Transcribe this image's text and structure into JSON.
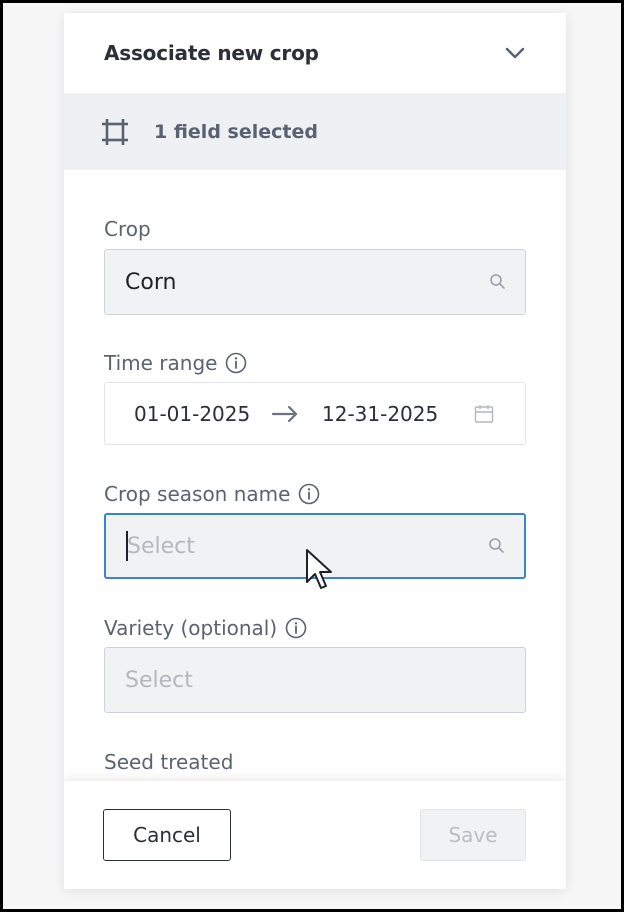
{
  "panel": {
    "title": "Associate new crop",
    "selection_text": "1 field selected"
  },
  "crop": {
    "label": "Crop",
    "value": "Corn",
    "placeholder": ""
  },
  "time_range": {
    "label": "Time range",
    "start": "01-01-2025",
    "end": "12-31-2025"
  },
  "crop_season": {
    "label": "Crop season name",
    "placeholder": "Select",
    "value": ""
  },
  "variety": {
    "label": "Variety (optional)",
    "placeholder": "Select",
    "value": ""
  },
  "seed_treated": {
    "label": "Seed treated"
  },
  "footer": {
    "cancel_label": "Cancel",
    "save_label": "Save"
  },
  "colors": {
    "accent_focus": "#3b82d4",
    "text_primary": "#2b2f38",
    "text_label": "#5c6370",
    "field_bg": "#f1f2f4",
    "selected_bar_bg": "#eef0f3"
  },
  "icons": [
    "chevron-down-icon",
    "field-selection-icon",
    "search-icon",
    "info-icon",
    "arrow-right-icon",
    "calendar-icon",
    "mouse-cursor-icon"
  ]
}
